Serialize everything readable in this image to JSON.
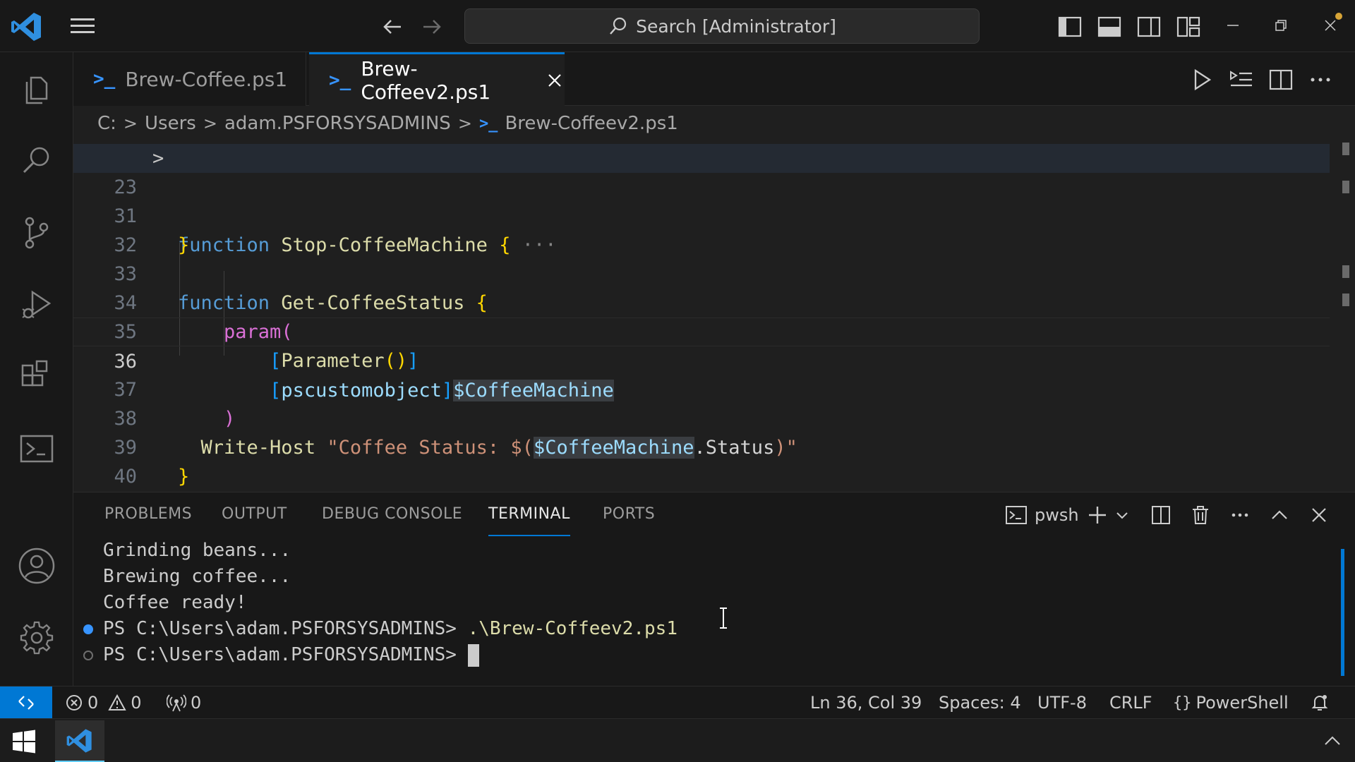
{
  "titlebar": {
    "search_placeholder": "Search [Administrator]"
  },
  "tabs": [
    {
      "label": "Brew-Coffee.ps1",
      "active": false
    },
    {
      "label": "Brew-Coffeev2.ps1",
      "active": true
    }
  ],
  "breadcrumb": {
    "parts": [
      "C:",
      "Users",
      "adam.PSFORSYSADMINS",
      "Brew-Coffeev2.ps1"
    ]
  },
  "editor": {
    "line_numbers": [
      "23",
      "31",
      "32",
      "33",
      "34",
      "35",
      "36",
      "37",
      "38",
      "39",
      "40"
    ],
    "code": {
      "l23_kw": "function",
      "l23_name": "Stop-CoffeeMachine",
      "l23_brace": "{",
      "l23_dots": "···",
      "l31": "}",
      "l33_kw": "function",
      "l33_name": "Get-CoffeeStatus",
      "l33_brace": "{",
      "l34_param": "param",
      "l34_paren": "(",
      "l35_open": "[",
      "l35_attr": "Parameter",
      "l35_parens": "()",
      "l35_close": "]",
      "l36_open": "[",
      "l36_type": "pscustomobject",
      "l36_close": "]",
      "l36_var": "$CoffeeMachine",
      "l37": ")",
      "l38_cmd": "Write-Host",
      "l38_str": "\"Coffee Status: $(",
      "l38_var": "$CoffeeMachine",
      "l38_prop": ".Status",
      "l38_end": ")\"",
      "l39": "}"
    }
  },
  "panel": {
    "tabs": [
      "PROBLEMS",
      "OUTPUT",
      "DEBUG CONSOLE",
      "TERMINAL",
      "PORTS"
    ],
    "active_tab": "TERMINAL",
    "shell_label": "pwsh",
    "terminal_lines": [
      "Grinding beans...",
      "Brewing coffee...",
      "Coffee ready!"
    ],
    "prompt": "PS C:\\Users\\adam.PSFORSYSADMINS>",
    "command": ".\\Brew-Coffeev2.ps1"
  },
  "statusbar": {
    "errors": "0",
    "warnings": "0",
    "ports": "0",
    "position": "Ln 36, Col 39",
    "spaces": "Spaces: 4",
    "encoding": "UTF-8",
    "eol": "CRLF",
    "language": "PowerShell"
  },
  "colors": {
    "accent": "#0078d4",
    "keyword": "#569cd6",
    "function": "#dcdcaa",
    "string": "#ce9178",
    "variable": "#9cdcfe",
    "type": "#4ec9b0"
  }
}
